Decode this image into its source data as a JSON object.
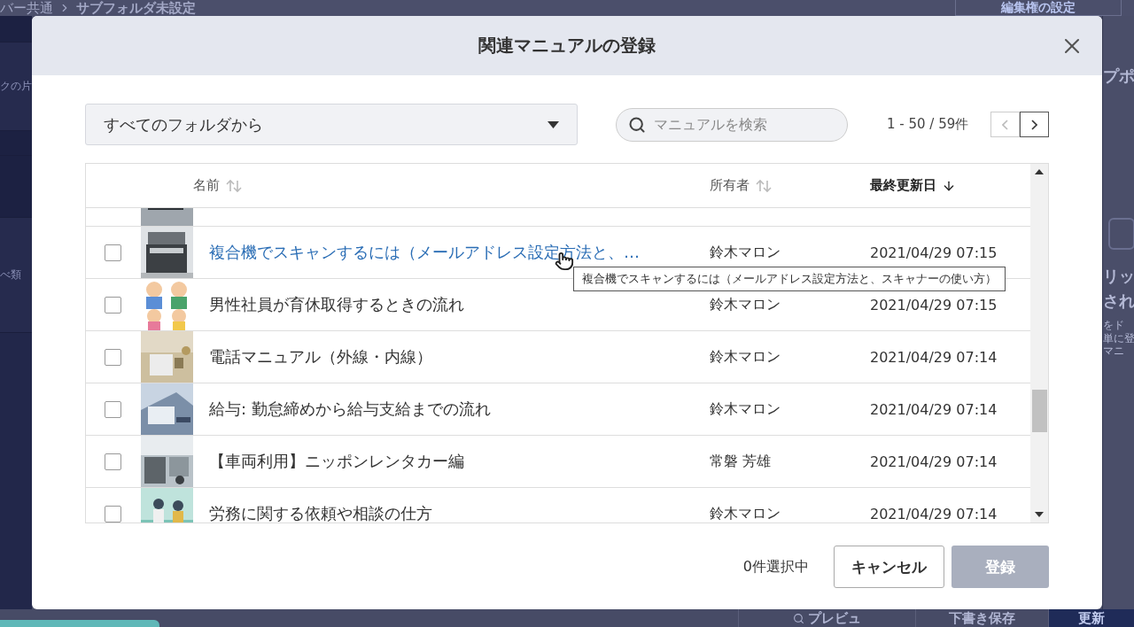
{
  "background": {
    "breadcrumb": [
      "バー共通",
      "サブフォルダ未設定"
    ],
    "top_button": "編集権の設定",
    "left_texts": [
      "クの片",
      "べ類"
    ],
    "right_texts": [
      "プポ",
      "リッ",
      "され",
      "をド",
      "単に登",
      "マニ"
    ],
    "bottom_buttons": [
      {
        "label": "プレビュ",
        "kind": "preview"
      },
      {
        "label": "下書き保存",
        "kind": "plain"
      },
      {
        "label": "更新",
        "kind": "primary"
      }
    ]
  },
  "dialog": {
    "title": "関連マニュアルの登録",
    "folder_select": {
      "value": "すべてのフォルダから"
    },
    "search": {
      "placeholder": "マニュアルを検索"
    },
    "pager": {
      "text": "1 - 50 / 59件",
      "prev_disabled": true,
      "next_disabled": false
    },
    "columns": [
      {
        "label": "名前",
        "sorted": false
      },
      {
        "label": "所有者",
        "sorted": false
      },
      {
        "label": "最終更新日",
        "sorted": true
      }
    ],
    "rows": [
      {
        "kind": "clipped"
      },
      {
        "kind": "manual",
        "title": "複合機でスキャンするには（メールアドレス設定方法と、…",
        "owner": "鈴木マロン",
        "date": "2021/04/29 07:15",
        "checked": false,
        "hovered": true
      },
      {
        "kind": "manual",
        "title": "男性社員が育休取得するときの流れ",
        "owner": "鈴木マロン",
        "date": "2021/04/29 07:15",
        "checked": false,
        "hovered": false
      },
      {
        "kind": "manual",
        "title": "電話マニュアル（外線・内線）",
        "owner": "鈴木マロン",
        "date": "2021/04/29 07:14",
        "checked": false,
        "hovered": false
      },
      {
        "kind": "manual",
        "title": "給与: 勤怠締めから給与支給までの流れ",
        "owner": "鈴木マロン",
        "date": "2021/04/29 07:14",
        "checked": false,
        "hovered": false
      },
      {
        "kind": "manual",
        "title": "【車両利用】ニッポンレンタカー編",
        "owner": "常磐 芳雄",
        "date": "2021/04/29 07:14",
        "checked": false,
        "hovered": false
      },
      {
        "kind": "manual",
        "title": "労務に関する依頼や相談の仕方",
        "owner": "鈴木マロン",
        "date": "2021/04/29 07:14",
        "checked": false,
        "hovered": false
      }
    ],
    "tooltip": "複合機でスキャンするには（メールアドレス設定方法と、スキャナーの使い方）",
    "selection_count": "0件選択中",
    "cancel_button": "キャンセル",
    "register_button": {
      "label": "登録",
      "disabled": true
    }
  }
}
